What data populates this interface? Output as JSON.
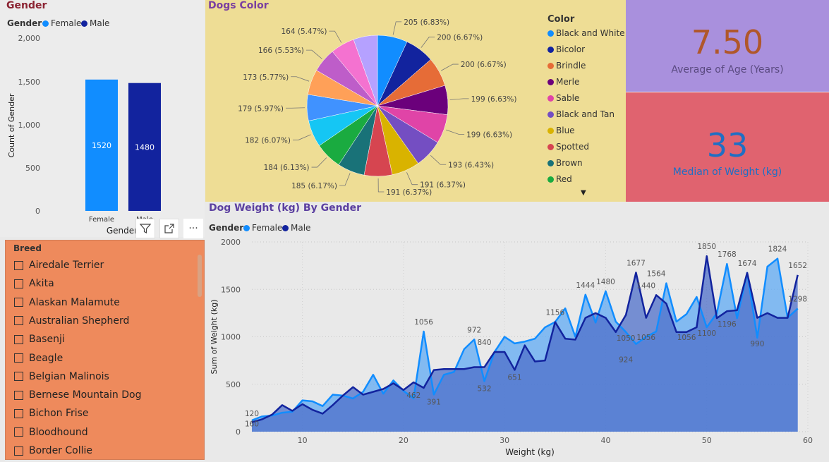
{
  "gender_panel": {
    "title": "Gender",
    "legend_label": "Gender",
    "legend_items": [
      {
        "label": "Female",
        "color": "#118dff"
      },
      {
        "label": "Male",
        "color": "#12239e"
      }
    ],
    "ylabel": "Count of Gender",
    "xlabel": "Gender",
    "ticks": [
      "2,000",
      "1,500",
      "1,000",
      "500",
      "0"
    ],
    "bars": [
      {
        "category": "Female",
        "value": 1520,
        "label": "1520",
        "color": "#118dff"
      },
      {
        "category": "Male",
        "value": 1480,
        "label": "1480",
        "color": "#12239e"
      }
    ],
    "ylim": [
      0,
      2000
    ]
  },
  "visual_toolbar": {
    "filter_icon": "filter-icon",
    "focus_icon": "focus-mode-icon",
    "more_label": "···"
  },
  "dogs_color": {
    "title": "Dogs Color",
    "legend_title": "Color",
    "chart_data": {
      "type": "pie",
      "title": "Dogs Color",
      "slices": [
        {
          "label": "Black and White",
          "value": 205,
          "text": "205 (6.83%)",
          "color": "#118dff"
        },
        {
          "label": "Bicolor",
          "value": 200,
          "text": "200 (6.67%)",
          "color": "#12239e"
        },
        {
          "label": "Brindle",
          "value": 200,
          "text": "200 (6.67%)",
          "color": "#e66c37"
        },
        {
          "label": "Merle",
          "value": 199,
          "text": "199 (6.63%)",
          "color": "#6b007b"
        },
        {
          "label": "Sable",
          "value": 199,
          "text": "199 (6.63%)",
          "color": "#e044a7"
        },
        {
          "label": "Black and Tan",
          "value": 193,
          "text": "193 (6.43%)",
          "color": "#744ec2"
        },
        {
          "label": "Blue",
          "value": 191,
          "text": "191 (6.37%)",
          "color": "#d9b300"
        },
        {
          "label": "Spotted",
          "value": 191,
          "text": "191 (6.37%)",
          "color": "#d64550"
        },
        {
          "label": "Brown",
          "value": 185,
          "text": "185 (6.17%)",
          "color": "#197278"
        },
        {
          "label": "Red",
          "value": 184,
          "text": "184 (6.13%)",
          "color": "#1aab40"
        },
        {
          "label": "",
          "value": 182,
          "text": "182 (6.07%)",
          "color": "#15c6f4"
        },
        {
          "label": "",
          "value": 179,
          "text": "179 (5.97%)",
          "color": "#4092ff"
        },
        {
          "label": "",
          "value": 173,
          "text": "173 (5.77%)",
          "color": "#ffa058"
        },
        {
          "label": "",
          "value": 166,
          "text": "166 (5.53%)",
          "color": "#be5dc9"
        },
        {
          "label": "",
          "value": 164,
          "text": "164 (5.47%)",
          "color": "#f472d0"
        },
        {
          "label": "",
          "value": 164,
          "text": "",
          "color": "#b5a1ff"
        }
      ]
    }
  },
  "age_card": {
    "value": "7.50",
    "label": "Average of Age (Years)"
  },
  "weight_card": {
    "value": "33",
    "label": "Median of Weight (kg)"
  },
  "weight_chart": {
    "title": "Dog Weight (kg) By Gender",
    "legend_label": "Gender",
    "legend_items": [
      {
        "label": "Female",
        "color": "#118dff"
      },
      {
        "label": "Male",
        "color": "#12239e"
      }
    ],
    "chart_data": {
      "type": "area",
      "title": "Dog Weight (kg) By Gender",
      "xlabel": "Weight (kg)",
      "ylabel": "Sum of Weight (kg)",
      "xlim": [
        5,
        60
      ],
      "ylim": [
        0,
        2000
      ],
      "xticks": [
        10,
        20,
        30,
        40,
        50,
        60
      ],
      "yticks": [
        0,
        500,
        1000,
        1500,
        2000
      ],
      "x": [
        5,
        6,
        7,
        8,
        9,
        10,
        11,
        12,
        13,
        14,
        15,
        16,
        17,
        18,
        19,
        20,
        21,
        22,
        23,
        24,
        25,
        26,
        27,
        28,
        29,
        30,
        31,
        32,
        33,
        34,
        35,
        36,
        37,
        38,
        39,
        40,
        41,
        42,
        43,
        44,
        45,
        46,
        47,
        48,
        49,
        50,
        51,
        52,
        53,
        54,
        55,
        56,
        57,
        58,
        59
      ],
      "series": [
        {
          "name": "Female",
          "color": "#118dff",
          "values": [
            120,
            160,
            170,
            200,
            210,
            330,
            320,
            270,
            390,
            380,
            350,
            420,
            600,
            400,
            540,
            430,
            350,
            1056,
            391,
            600,
            630,
            870,
            972,
            532,
            840,
            1000,
            930,
            950,
            980,
            1100,
            1156,
            1300,
            1000,
            1444,
            1150,
            1480,
            1160,
            1050,
            924,
            1000,
            1056,
            1564,
            1160,
            1240,
            1420,
            1100,
            1250,
            1768,
            1196,
            1674,
            990,
            1740,
            1824,
            1200,
            1298
          ]
        },
        {
          "name": "Male",
          "color": "#12239e",
          "values": [
            100,
            130,
            180,
            280,
            220,
            290,
            230,
            190,
            280,
            380,
            470,
            390,
            420,
            450,
            510,
            440,
            520,
            462,
            650,
            660,
            660,
            660,
            680,
            680,
            840,
            840,
            651,
            910,
            740,
            750,
            1156,
            980,
            970,
            1200,
            1250,
            1200,
            1050,
            1230,
            1677,
            1200,
            1440,
            1350,
            1050,
            1050,
            1100,
            1850,
            1196,
            1270,
            1280,
            1674,
            1200,
            1250,
            1200,
            1200,
            1652
          ]
        }
      ],
      "annotations": [
        "120",
        "160",
        "1056",
        "391",
        "462",
        "972",
        "840",
        "532",
        "651",
        "1156",
        "1444",
        "1480",
        "1677",
        "1564",
        "1440",
        "1050",
        "1056",
        "924",
        "1056",
        "1850",
        "1768",
        "1100",
        "1674",
        "1196",
        "990",
        "1824",
        "1652",
        "1298"
      ]
    }
  },
  "breed_panel": {
    "title": "Breed",
    "items": [
      "Airedale Terrier",
      "Akita",
      "Alaskan Malamute",
      "Australian Shepherd",
      "Basenji",
      "Beagle",
      "Belgian Malinois",
      "Bernese Mountain Dog",
      "Bichon Frise",
      "Bloodhound",
      "Border Collie"
    ]
  }
}
